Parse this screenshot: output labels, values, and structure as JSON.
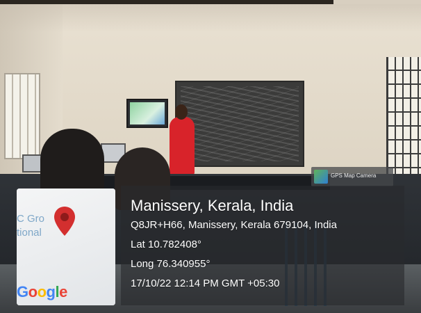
{
  "gps_badge": {
    "label": "GPS Map Camera",
    "icon": "gps-map-camera-icon"
  },
  "map": {
    "label_line1": "C Gro",
    "label_line2": "tional",
    "pin_icon": "map-pin-icon",
    "pin_color": "#d32f2f",
    "provider_logo": "Google"
  },
  "location": {
    "title": "Manissery, Kerala, India",
    "address": "Q8JR+H66, Manissery, Kerala 679104, India",
    "latitude": "Lat 10.782408°",
    "longitude": "Long 76.340955°",
    "datetime": "17/10/22 12:14 PM GMT +05:30"
  }
}
